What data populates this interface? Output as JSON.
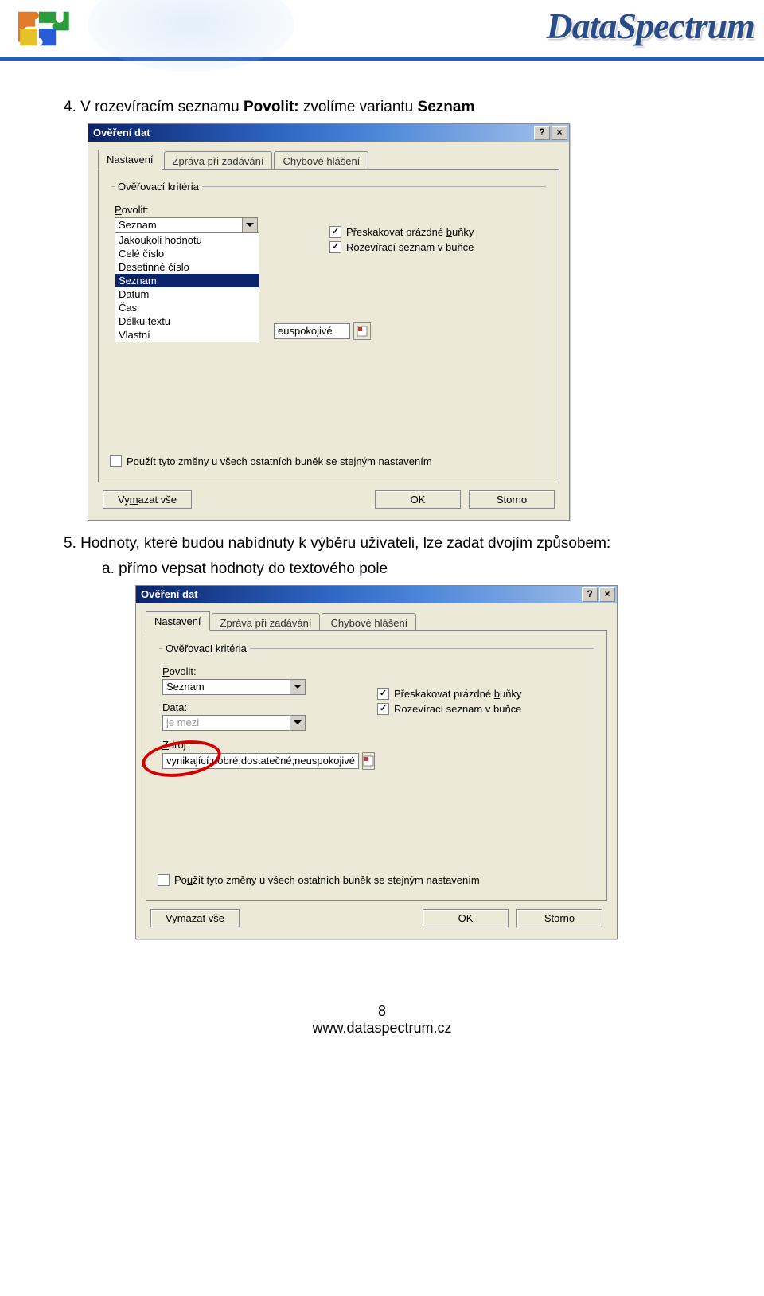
{
  "brand": "DataSpectrum",
  "step4_text_a": "4.   V rozevíracím seznamu ",
  "step4_text_b": "Povolit:",
  "step4_text_c": " zvolíme variantu ",
  "step4_text_d": "Seznam",
  "step5_text": "5.   Hodnoty, které budou nabídnuty k výběru uživateli, lze zadat dvojím způsobem:",
  "step5a_text": "a.   přímo vepsat hodnoty do textového pole",
  "dialog": {
    "title": "Ověření dat",
    "tabs": [
      "Nastavení",
      "Zpráva při zadávání",
      "Chybové hlášení"
    ],
    "criteria_label": "Ověřovací kritéria",
    "allow_label": "Povolit:",
    "data_label": "Data:",
    "source_label": "Zdroj:",
    "allow_value": "Seznam",
    "data_value": "je mezi",
    "list_options": [
      "Jakoukoli hodnotu",
      "Celé číslo",
      "Desetinné číslo",
      "Seznam",
      "Datum",
      "Čas",
      "Délku textu",
      "Vlastní"
    ],
    "chk_skip_empty": "Přeskakovat prázdné buňky",
    "chk_dropdown": "Rozevírací seznam v buňce",
    "chk_apply_all": "Použít tyto změny u všech ostatních buněk se stejným nastavením",
    "source_value": "vynikající;dobré;dostatečné;neuspokojivé",
    "source_peek": "euspokojivé",
    "btn_clear": "Vymazat vše",
    "btn_ok": "OK",
    "btn_cancel": "Storno"
  },
  "footer": {
    "page": "8",
    "url": "www.dataspectrum.cz"
  }
}
